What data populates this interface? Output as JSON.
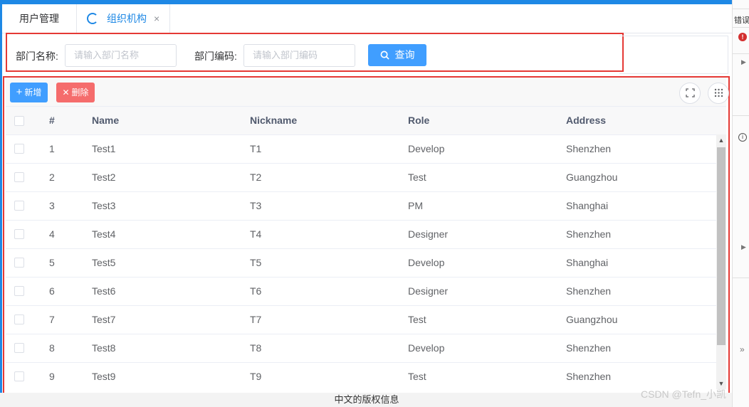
{
  "tabs": [
    {
      "label": "用户管理"
    },
    {
      "label": "组织机构",
      "close": "×"
    }
  ],
  "search": {
    "dept_name_label": "部门名称:",
    "dept_name_placeholder": "请输入部门名称",
    "dept_code_label": "部门编码:",
    "dept_code_placeholder": "请输入部门编码",
    "query_button": "查询"
  },
  "toolbar": {
    "add_label": "新增",
    "delete_label": "删除"
  },
  "table": {
    "columns": [
      "#",
      "Name",
      "Nickname",
      "Role",
      "Address"
    ],
    "rows": [
      [
        "1",
        "Test1",
        "T1",
        "Develop",
        "Shenzhen"
      ],
      [
        "2",
        "Test2",
        "T2",
        "Test",
        "Guangzhou"
      ],
      [
        "3",
        "Test3",
        "T3",
        "PM",
        "Shanghai"
      ],
      [
        "4",
        "Test4",
        "T4",
        "Designer",
        "Shenzhen"
      ],
      [
        "5",
        "Test5",
        "T5",
        "Develop",
        "Shanghai"
      ],
      [
        "6",
        "Test6",
        "T6",
        "Designer",
        "Shenzhen"
      ],
      [
        "7",
        "Test7",
        "T7",
        "Test",
        "Guangzhou"
      ],
      [
        "8",
        "Test8",
        "T8",
        "Develop",
        "Shenzhen"
      ],
      [
        "9",
        "Test9",
        "T9",
        "Test",
        "Shenzhen"
      ]
    ]
  },
  "footer": {
    "text": "中文的版权信息"
  },
  "watermark": "CSDN @Tefn_小凯",
  "right_panel": {
    "text": "错误"
  },
  "colors": {
    "primary": "#409eff",
    "danger": "#f56c6c",
    "highlight_border": "#e53935",
    "tab_active": "#1e88e5"
  },
  "icons": [
    "loading-icon",
    "close-icon",
    "search-icon",
    "plus-icon",
    "delete-icon",
    "fullscreen-icon",
    "grid-icon",
    "error-icon",
    "info-icon"
  ]
}
